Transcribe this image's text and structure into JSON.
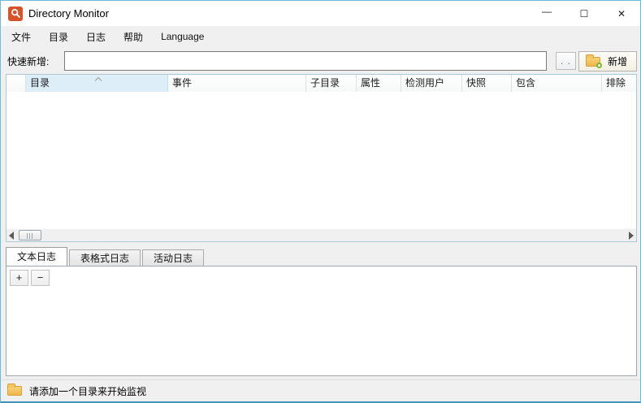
{
  "window": {
    "title": "Directory Monitor",
    "minimize_glyph": "—",
    "maximize_glyph": "☐",
    "close_glyph": "✕"
  },
  "menu": {
    "file": "文件",
    "directory": "目录",
    "log": "日志",
    "help": "帮助",
    "language": "Language"
  },
  "quick_add": {
    "label": "快速新增:",
    "input_value": "",
    "browse_button": ". .",
    "add_button": "新增"
  },
  "table": {
    "columns": {
      "spacer": "",
      "directory": "目录",
      "event": "事件",
      "subdirectory": "子目录",
      "attributes": "属性",
      "detect_user": "检测用户",
      "snapshot": "快照",
      "include": "包含",
      "exclude": "排除"
    },
    "sorted_column": "目录",
    "sort_order": "ascending",
    "rows": []
  },
  "tabs": {
    "text_log": "文本日志",
    "table_log": "表格式日志",
    "activity_log": "活动日志",
    "active_tab": "文本日志"
  },
  "log_panel": {
    "increase_button": "+",
    "decrease_button": "−",
    "content": ""
  },
  "status_bar": {
    "message": "请添加一个目录来开始监视"
  },
  "colors": {
    "app_icon": "#d6532c",
    "sorted_column_bg": "#ddeef8",
    "window_border": "#6fb9d9",
    "folder_icon": "#f3c65f",
    "add_badge_ring": "#7cb82f"
  }
}
